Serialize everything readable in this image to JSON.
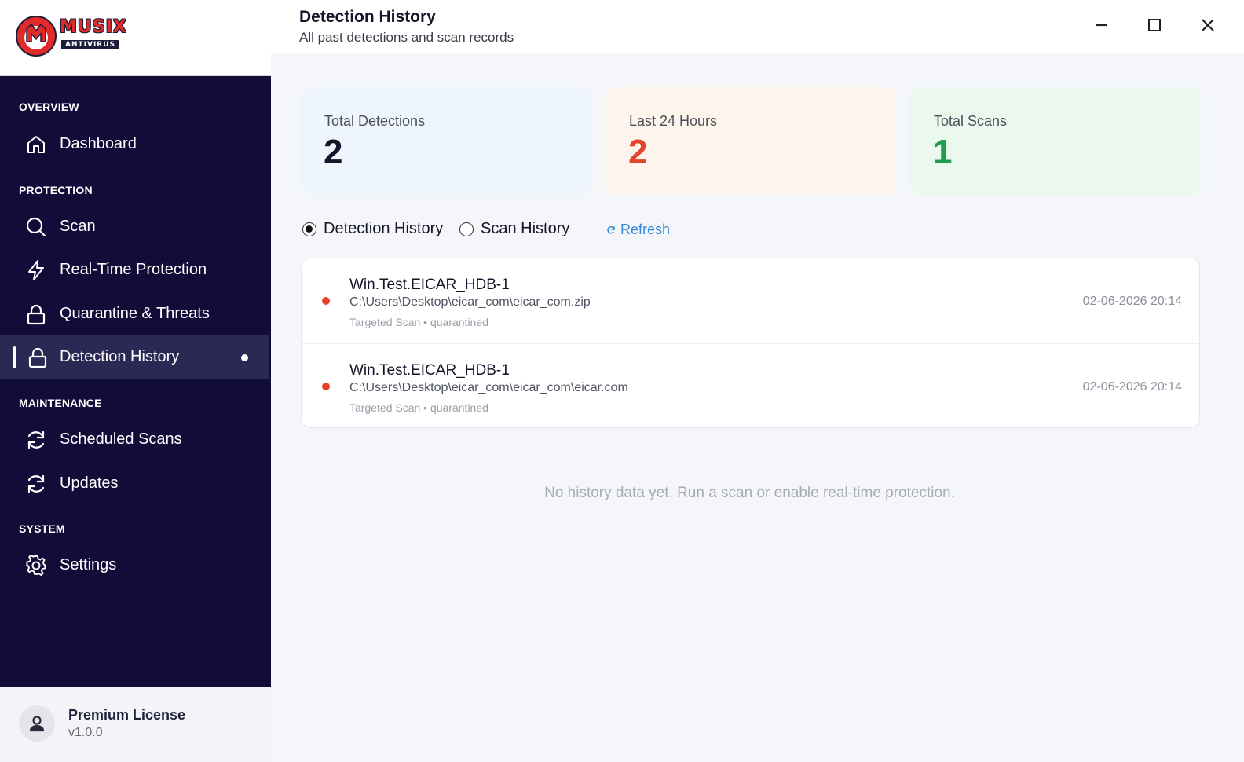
{
  "brand": {
    "name": "MUSIX",
    "tagline": "ANTIVIRUS",
    "accent_color": "#e12a2a"
  },
  "sidebar": {
    "sections": {
      "overview": "OVERVIEW",
      "protection": "PROTECTION",
      "maintenance": "MAINTENANCE",
      "system": "SYSTEM"
    },
    "items": [
      {
        "label": "Dashboard",
        "icon": "home-icon"
      },
      {
        "label": "Scan",
        "icon": "search-icon"
      },
      {
        "label": "Real-Time Protection",
        "icon": "lightning-icon"
      },
      {
        "label": "Quarantine & Threats",
        "icon": "lock-icon"
      },
      {
        "label": "Detection History",
        "icon": "lock-icon",
        "active": true
      },
      {
        "label": "Scheduled Scans",
        "icon": "refresh-icon"
      },
      {
        "label": "Updates",
        "icon": "refresh-icon"
      },
      {
        "label": "Settings",
        "icon": "gear-icon"
      }
    ],
    "license": {
      "name": "Premium License",
      "version": "v1.0.0"
    },
    "background_color": "#110d38"
  },
  "header": {
    "title": "Detection History",
    "subtitle": "All past detections and scan records"
  },
  "stats": [
    {
      "label": "Total Detections",
      "value": "2",
      "color": "#15152a",
      "bg": "#eff5fd"
    },
    {
      "label": "Last 24 Hours",
      "value": "2",
      "color": "#e6432e",
      "bg": "#fdf5ec"
    },
    {
      "label": "Total Scans",
      "value": "1",
      "color": "#1e9e4b",
      "bg": "#eaf8ee"
    }
  ],
  "view_toggle": {
    "detection_label": "Detection History",
    "scan_label": "Scan History",
    "selected": "Detection History",
    "refresh_label": "Refresh"
  },
  "detections": [
    {
      "name": "Win.Test.EICAR_HDB-1",
      "path": "C:\\Users\\Desktop\\eicar_com\\eicar_com.zip",
      "meta": "Targeted Scan • quarantined",
      "time": "02-06-2026 20:14",
      "severity_color": "#e6432e"
    },
    {
      "name": "Win.Test.EICAR_HDB-1",
      "path": "C:\\Users\\Desktop\\eicar_com\\eicar_com\\eicar.com",
      "meta": "Targeted Scan • quarantined",
      "time": "02-06-2026 20:14",
      "severity_color": "#e6432e"
    }
  ],
  "empty_message": "No history data yet. Run a scan or enable real-time protection."
}
